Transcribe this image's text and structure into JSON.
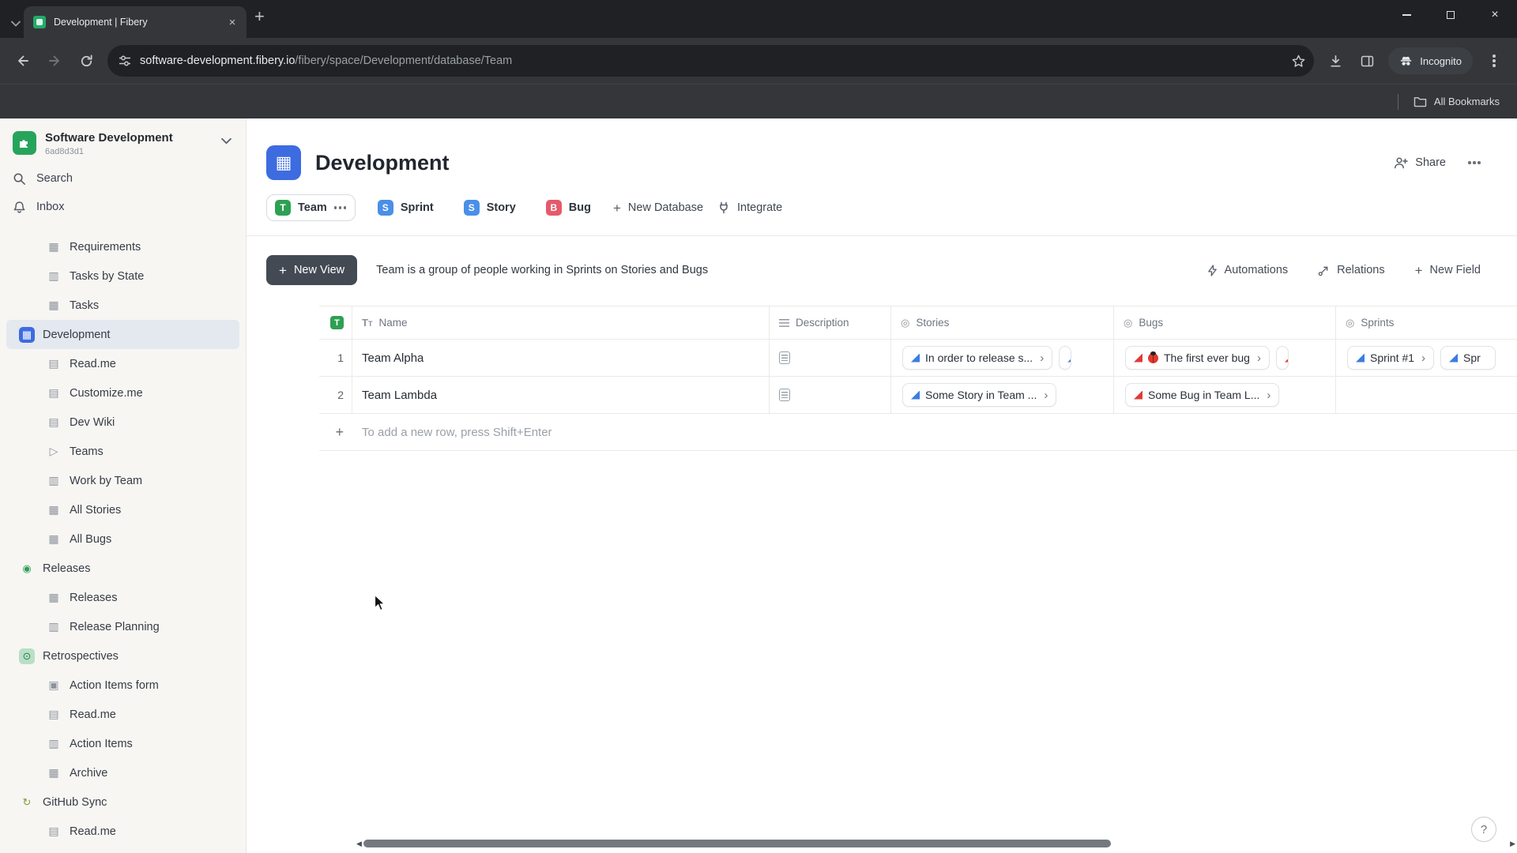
{
  "browser": {
    "tab_title": "Development | Fibery",
    "url_domain": "software-development.fibery.io",
    "url_path": "/fibery/space/Development/database/Team",
    "incognito_label": "Incognito",
    "bookmarks_label": "All Bookmarks"
  },
  "sidebar": {
    "workspace_name": "Software Development",
    "workspace_id": "6ad8d3d1",
    "search_label": "Search",
    "inbox_label": "Inbox",
    "items": [
      {
        "label": "Requirements",
        "icon": "table",
        "level": 1
      },
      {
        "label": "Tasks by State",
        "icon": "board",
        "level": 1
      },
      {
        "label": "Tasks",
        "icon": "table",
        "level": 1
      },
      {
        "label": "Development",
        "icon": "app-development",
        "level": 0,
        "selected": true
      },
      {
        "label": "Read.me",
        "icon": "doc",
        "level": 1
      },
      {
        "label": "Customize.me",
        "icon": "doc",
        "level": 1
      },
      {
        "label": "Dev Wiki",
        "icon": "doc",
        "level": 1
      },
      {
        "label": "Teams",
        "icon": "play",
        "level": 1
      },
      {
        "label": "Work by Team",
        "icon": "board",
        "level": 1
      },
      {
        "label": "All Stories",
        "icon": "table",
        "level": 1
      },
      {
        "label": "All Bugs",
        "icon": "table",
        "level": 1
      },
      {
        "label": "Releases",
        "icon": "app-releases",
        "level": 0
      },
      {
        "label": "Releases",
        "icon": "table",
        "level": 1
      },
      {
        "label": "Release Planning",
        "icon": "board",
        "level": 1
      },
      {
        "label": "Retrospectives",
        "icon": "app-retrospectives",
        "level": 0
      },
      {
        "label": "Action Items form",
        "icon": "form",
        "level": 1
      },
      {
        "label": "Read.me",
        "icon": "doc",
        "level": 1
      },
      {
        "label": "Action Items",
        "icon": "board",
        "level": 1
      },
      {
        "label": "Archive",
        "icon": "table",
        "level": 1
      },
      {
        "label": "GitHub Sync",
        "icon": "app-github",
        "level": 0
      },
      {
        "label": "Read.me",
        "icon": "doc",
        "level": 1
      }
    ]
  },
  "header": {
    "title": "Development",
    "share_label": "Share"
  },
  "databases": {
    "tabs": [
      {
        "label": "Team",
        "letter": "T",
        "color": "#2ea052",
        "selected": true
      },
      {
        "label": "Sprint",
        "letter": "S",
        "color": "#4a8fe8",
        "selected": false
      },
      {
        "label": "Story",
        "letter": "S",
        "color": "#4a8fe8",
        "selected": false
      },
      {
        "label": "Bug",
        "letter": "B",
        "color": "#e45a6b",
        "selected": false
      }
    ],
    "new_database_label": "New Database",
    "integrate_label": "Integrate"
  },
  "view_toolbar": {
    "new_view_label": "New View",
    "description": "Team is a group of people working in Sprints on Stories and Bugs",
    "automations_label": "Automations",
    "relations_label": "Relations",
    "new_field_label": "New Field"
  },
  "table": {
    "entity_letter": "T",
    "entity_color": "#2ea052",
    "chip_colors": {
      "story": "#3a7de2",
      "bug": "#df3b38",
      "sprint": "#3a7de2"
    },
    "columns": [
      {
        "label": "Name"
      },
      {
        "label": "Description"
      },
      {
        "label": "Stories"
      },
      {
        "label": "Bugs"
      },
      {
        "label": "Sprints"
      }
    ],
    "rows": [
      {
        "num": "1",
        "name": "Team Alpha",
        "has_description": true,
        "stories": [
          {
            "text": "In order to release s..."
          },
          {
            "text": "",
            "clipped": true
          }
        ],
        "bugs": [
          {
            "text": "The first ever bug",
            "ladybug": true
          },
          {
            "text": "",
            "clipped": true
          }
        ],
        "sprints": [
          {
            "text": "Sprint #1"
          },
          {
            "text": "Spr",
            "clipped": true
          }
        ]
      },
      {
        "num": "2",
        "name": "Team Lambda",
        "has_description": true,
        "stories": [
          {
            "text": "Some Story in Team ..."
          }
        ],
        "bugs": [
          {
            "text": "Some Bug in Team L..."
          }
        ],
        "sprints": []
      }
    ],
    "add_row_hint": "To add a new row, press Shift+Enter"
  },
  "help_label": "?"
}
